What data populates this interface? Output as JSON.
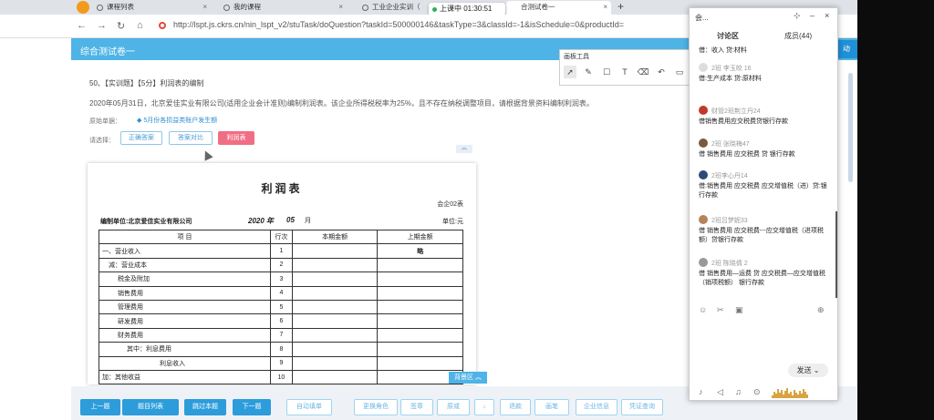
{
  "browser": {
    "tabs": [
      {
        "label": "课程列表"
      },
      {
        "label": "我的课程"
      },
      {
        "label": "工业企业实训（"
      },
      {
        "label": "合测试卷一"
      }
    ],
    "add_tab": "+",
    "url": "http://lspt.js.ckrs.cn/nin_lspt_v2/stuTask/doQuestion?taskId=500000146&taskType=3&classId=-1&isSchedule=0&productId="
  },
  "recording": {
    "label": "上课中 01:30:51"
  },
  "exam": {
    "title": "综合测试卷一",
    "right_btn": "动"
  },
  "question": {
    "title": "50、【实训题】【5分】利润表的编制",
    "desc": "2020年05月31日，北京爱佳实业有限公司(适用企业会计准则)编制利润表。该企业所得税税率为25%，且不存在纳税调整项目，请根据背景资料编制利润表。",
    "original_label": "原始单据：",
    "original_link": "5月份各损益类账户发生额",
    "select_label": "请选择：",
    "options": [
      {
        "label": "正确答案"
      },
      {
        "label": "答案对比"
      },
      {
        "label": "利润表"
      }
    ],
    "collapse": "︽"
  },
  "statement": {
    "title": "利润表",
    "code": "会企02表",
    "company": "编制单位:北京爱佳实业有限公司",
    "year": "2020 年",
    "month_value": "05",
    "month": "月",
    "unit": "单位:元",
    "headers": [
      "项 目",
      "行次",
      "本期金额",
      "上期金额"
    ],
    "rows": [
      {
        "item": "一、营业收入",
        "no": "1",
        "cur": "",
        "prev": "略"
      },
      {
        "item": "减：营业成本",
        "no": "2",
        "cur": "",
        "prev": ""
      },
      {
        "item": "税金及附加",
        "no": "3",
        "cur": "",
        "prev": ""
      },
      {
        "item": "销售费用",
        "no": "4",
        "cur": "",
        "prev": ""
      },
      {
        "item": "管理费用",
        "no": "5",
        "cur": "",
        "prev": ""
      },
      {
        "item": "研发费用",
        "no": "6",
        "cur": "",
        "prev": ""
      },
      {
        "item": "财务费用",
        "no": "7",
        "cur": "",
        "prev": ""
      },
      {
        "item": "其中：利息费用",
        "no": "8",
        "cur": "",
        "prev": ""
      },
      {
        "item": "利息收入",
        "no": "9",
        "cur": "",
        "prev": ""
      },
      {
        "item": "加：其他收益",
        "no": "10",
        "cur": "",
        "prev": ""
      }
    ],
    "bg_area": "背景区 ︽"
  },
  "bottom": {
    "buttons": [
      {
        "label": "上一题"
      },
      {
        "label": "题目列表"
      },
      {
        "label": "跳过本题"
      },
      {
        "label": "下一题"
      },
      {
        "label": "自动填单"
      },
      {
        "label": "更换角色"
      },
      {
        "label": "签章"
      },
      {
        "label": "原或"
      },
      {
        "label": "↓"
      },
      {
        "label": "退款"
      },
      {
        "label": "画笔"
      },
      {
        "label": "企业信息"
      },
      {
        "label": "凭证查询"
      }
    ]
  },
  "drawing_tools": {
    "title": "画板工具",
    "tools": [
      "pointer-icon",
      "pen-icon",
      "rect-icon",
      "text-icon",
      "eraser-icon",
      "undo-icon",
      "screen-icon"
    ]
  },
  "chat": {
    "menu": "会...",
    "tabs": [
      {
        "label": "讨论区"
      },
      {
        "label": "成员(44)"
      }
    ],
    "send": "发送",
    "messages": [
      {
        "name": "",
        "text": "借：收入 贷:材料"
      },
      {
        "name": "2班 李玉皎 16",
        "text": "借:生产成本 贷:原材料"
      },
      {
        "name": "财管2班荆立丹24",
        "text": "借销售费用应交税费贷银行存款"
      },
      {
        "name": "2班 张晓梅47",
        "text": "借 销售费用 应交税费 贷 银行存款"
      },
      {
        "name": "2班李心丹14",
        "text": "借:销售费用 应交税费 应交增值税（进）贷:银行存款"
      },
      {
        "name": "2班吕梦妮33",
        "text": "借 销售费用 应交税费---应交增值税（进项税额）贷银行存款"
      },
      {
        "name": "2班 陈晓倩 2",
        "text": "借 销售费用—运费 贷 应交税费—应交增值税（销项税额） 银行存款"
      }
    ]
  }
}
